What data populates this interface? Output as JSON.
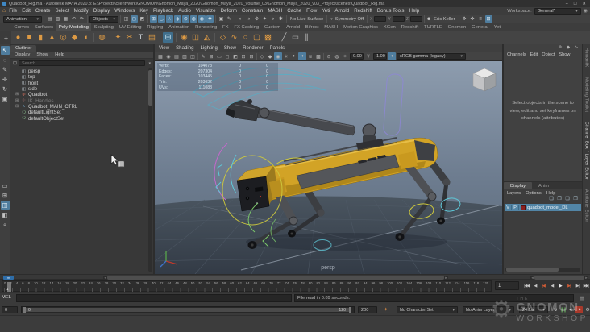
{
  "titlebar": {
    "title": "QuadBot_Rig.ma - Autodesk MAYA 2020.3: E:\\Projects\\clientWork\\GNOMON\\Gnomon_Maya_2020\\Gnomon_Maya_2020_volume_03\\Gnomon_Maya_2020_v03_Project\\scenes\\QuadBot_Rig.ma",
    "controls": [
      {
        "name": "minimize-button",
        "glyph": "−"
      },
      {
        "name": "maximize-button",
        "glyph": "□"
      },
      {
        "name": "close-button",
        "glyph": "✕"
      }
    ]
  },
  "menubar": {
    "home_icon": "⌂",
    "items": [
      "File",
      "Edit",
      "Create",
      "Select",
      "Modify",
      "Display",
      "Windows",
      "Key",
      "Playback",
      "Audio",
      "Visualize",
      "Deform",
      "Constrain",
      "MASH",
      "Cache",
      "Flow",
      "Yeti",
      "Arnold",
      "Redshift",
      "Bonus Tools",
      "Help"
    ],
    "workspace_label": "Workspace:",
    "workspace_value": "General*",
    "lock_glyph": "◉"
  },
  "statusline": {
    "mode_dropdown": "Animation",
    "file_icons": [
      {
        "name": "new-scene-icon",
        "glyph": "▤"
      },
      {
        "name": "open-scene-icon",
        "glyph": "▨"
      },
      {
        "name": "save-scene-icon",
        "glyph": "▦"
      },
      {
        "name": "undo-icon",
        "glyph": "↶"
      },
      {
        "name": "redo-icon",
        "glyph": "↷"
      }
    ],
    "selection_dropdown": "Objects",
    "mask_icons": [
      {
        "name": "select-hierarchy-icon",
        "glyph": "◫"
      },
      {
        "name": "select-object-icon",
        "glyph": "◻",
        "active": true
      },
      {
        "name": "select-component-icon",
        "glyph": "◩"
      }
    ],
    "snap_icons": [
      {
        "name": "snap-grid-icon",
        "glyph": "⊞",
        "active": true
      },
      {
        "name": "snap-curve-icon",
        "glyph": "◡",
        "active": true
      },
      {
        "name": "snap-point-icon",
        "glyph": "∴",
        "active": true
      },
      {
        "name": "snap-projected-center-icon",
        "glyph": "◈",
        "active": true
      },
      {
        "name": "snap-view-plane-icon",
        "glyph": "⊙",
        "active": true
      },
      {
        "name": "make-live-icon",
        "glyph": "◍",
        "active": true
      },
      {
        "name": "quick-snap-icon",
        "glyph": "◉",
        "active": true
      },
      {
        "name": "snap-together-icon",
        "glyph": "❖",
        "active": true
      }
    ],
    "lock_icons": [
      {
        "name": "lock-selection-icon",
        "glyph": "▣"
      },
      {
        "name": "highlight-selection-icon",
        "glyph": "✎"
      }
    ],
    "render_icons": [
      {
        "name": "render-view-icon",
        "glyph": "◐"
      },
      {
        "name": "ipr-render-icon",
        "glyph": "◑"
      },
      {
        "name": "render-settings-icon",
        "glyph": "⚙"
      },
      {
        "name": "hypershade-icon",
        "glyph": "✦"
      },
      {
        "name": "light-editor-icon",
        "glyph": "◕"
      },
      {
        "name": "paint-effects-icon",
        "glyph": "✱"
      }
    ],
    "no_live_surface": "No Live Surface",
    "symmetry_label": "Symmetry Off",
    "xyz_labels": [
      "X",
      "Y",
      "Z"
    ],
    "user_icon": "☻",
    "user": "Eric Keller",
    "right_icons": [
      {
        "name": "modeling-toolkit-toggle-icon",
        "glyph": "❖"
      },
      {
        "name": "humanik-toggle-icon",
        "glyph": "✥"
      },
      {
        "name": "attribute-editor-toggle-icon",
        "glyph": "≡"
      },
      {
        "name": "channel-box-toggle-icon",
        "glyph": "⊞",
        "active": true
      }
    ]
  },
  "shelf": {
    "left_icons": [
      {
        "name": "shelf-tab-menu-icon",
        "glyph": "▾"
      },
      {
        "name": "shelf-options-icon",
        "glyph": "✚"
      }
    ],
    "tabs": [
      {
        "name": "shelf-tab-curves",
        "label": "Curves"
      },
      {
        "name": "shelf-tab-surfaces",
        "label": "Surfaces"
      },
      {
        "name": "shelf-tab-poly-modeling",
        "label": "Poly Modeling",
        "active": true
      },
      {
        "name": "shelf-tab-sculpting",
        "label": "Sculpting"
      },
      {
        "name": "shelf-tab-uv-editing",
        "label": "UV Editing"
      },
      {
        "name": "shelf-tab-rigging",
        "label": "Rigging"
      },
      {
        "name": "shelf-tab-animation",
        "label": "Animation"
      },
      {
        "name": "shelf-tab-rendering",
        "label": "Rendering"
      },
      {
        "name": "shelf-tab-fx",
        "label": "FX"
      },
      {
        "name": "shelf-tab-fx-caching",
        "label": "FX Caching"
      },
      {
        "name": "shelf-tab-custom",
        "label": "Custom"
      },
      {
        "name": "shelf-tab-arnold",
        "label": "Arnold"
      },
      {
        "name": "shelf-tab-bifrost",
        "label": "Bifrost"
      },
      {
        "name": "shelf-tab-mash",
        "label": "MASH"
      },
      {
        "name": "shelf-tab-motion-graphics",
        "label": "Motion Graphics"
      },
      {
        "name": "shelf-tab-xgen",
        "label": "XGen"
      },
      {
        "name": "shelf-tab-redshift",
        "label": "Redshift"
      },
      {
        "name": "shelf-tab-turtle",
        "label": "TURTLE"
      },
      {
        "name": "shelf-tab-gnomon",
        "label": "Gnomon"
      },
      {
        "name": "shelf-tab-general",
        "label": "General"
      },
      {
        "name": "shelf-tab-yeti",
        "label": "Yeti"
      }
    ],
    "icons": [
      {
        "name": "poly-sphere-icon",
        "glyph": "●"
      },
      {
        "name": "poly-cube-icon",
        "glyph": "■"
      },
      {
        "name": "poly-cylinder-icon",
        "glyph": "▮"
      },
      {
        "name": "poly-cone-icon",
        "glyph": "▲"
      },
      {
        "name": "poly-torus-icon",
        "glyph": "◎"
      },
      {
        "name": "poly-plane-icon",
        "glyph": "◆"
      },
      {
        "name": "poly-disc-icon",
        "glyph": "◖"
      },
      {
        "sep": true
      },
      {
        "name": "platonic-solid-icon",
        "glyph": "◍"
      },
      {
        "sep": true
      },
      {
        "name": "boolean-icon",
        "glyph": "✦"
      },
      {
        "name": "multi-cut-icon",
        "glyph": "✂"
      },
      {
        "name": "type-tool-icon",
        "glyph": "T",
        "color": "#cdd2d6"
      },
      {
        "name": "sweep-mesh-icon",
        "glyph": "▤"
      },
      {
        "sep": true
      },
      {
        "name": "modeling-toolkit-icon",
        "glyph": "⊞",
        "active": true
      },
      {
        "sep": true
      },
      {
        "name": "smooth-mesh-icon",
        "glyph": "◉"
      },
      {
        "name": "mirror-icon",
        "glyph": "◫"
      },
      {
        "name": "bevel-icon",
        "glyph": "◭"
      },
      {
        "sep": true
      },
      {
        "name": "quad-draw-icon",
        "glyph": "◇"
      },
      {
        "name": "curve-tool-icon",
        "glyph": "∿"
      },
      {
        "name": "circle-curve-icon",
        "glyph": "○"
      },
      {
        "name": "square-curve-icon",
        "glyph": "▢"
      },
      {
        "name": "lattice-icon",
        "glyph": "▩"
      },
      {
        "sep": true
      },
      {
        "name": "pencil-tool-icon",
        "glyph": "╱",
        "color": "#b5b5b5"
      },
      {
        "name": "frame-tool-icon",
        "glyph": "▭",
        "color": "#b5b5b5"
      },
      {
        "name": "hatch-tool-icon",
        "glyph": "∥",
        "color": "#b5b5b5"
      }
    ]
  },
  "toolbox": {
    "tools": [
      {
        "name": "select-tool",
        "glyph": "↖",
        "active": true
      },
      {
        "name": "lasso-select-tool",
        "glyph": "◌"
      },
      {
        "name": "paint-select-tool",
        "glyph": "✎"
      },
      {
        "name": "move-tool",
        "glyph": "✛"
      },
      {
        "name": "rotate-tool",
        "glyph": "↻"
      },
      {
        "name": "scale-tool",
        "glyph": "▣"
      }
    ],
    "layouts": [
      {
        "name": "layout-single-pane",
        "glyph": "▭"
      },
      {
        "name": "layout-four-pane",
        "glyph": "⊞"
      },
      {
        "name": "layout-two-pane",
        "glyph": "◫",
        "active": true
      },
      {
        "name": "layout-outliner-persp",
        "glyph": "◧"
      },
      {
        "name": "zoom-tool",
        "glyph": "⌕"
      }
    ]
  },
  "outliner": {
    "tab": "Outliner",
    "menus": [
      "Display",
      "Show",
      "Help"
    ],
    "search_placeholder": "Search...",
    "filter_icon": "⊡",
    "items": [
      {
        "name": "outliner-item-persp",
        "glyph": "◧",
        "glyphColor": "#a9afb5",
        "label": "persp",
        "indent": true
      },
      {
        "name": "outliner-item-top",
        "glyph": "◧",
        "glyphColor": "#a9afb5",
        "label": "top",
        "indent": true
      },
      {
        "name": "outliner-item-front",
        "glyph": "◧",
        "glyphColor": "#a9afb5",
        "label": "front",
        "indent": true
      },
      {
        "name": "outliner-item-side",
        "glyph": "◧",
        "glyphColor": "#a9afb5",
        "label": "side",
        "indent": true
      },
      {
        "name": "outliner-item-quadbot",
        "expander": "⊞",
        "glyph": "✛",
        "glyphColor": "#c06a5a",
        "label": "Quadbot"
      },
      {
        "name": "outliner-item-ik-handles",
        "expander": "⊞",
        "glyph": "✛",
        "glyphColor": "#9a6a6a",
        "label": "IK_Handles",
        "muted": true
      },
      {
        "name": "outliner-item-main-ctrl",
        "expander": "⊞",
        "glyph": "∿",
        "glyphColor": "#7ab0d4",
        "label": "Quadbot_MAIN_CTRL"
      },
      {
        "name": "outliner-item-default-light-set",
        "glyph": "❍",
        "glyphColor": "#86b98a",
        "label": "defaultLightSet",
        "indent": true
      },
      {
        "name": "outliner-item-default-object-set",
        "glyph": "❍",
        "glyphColor": "#86b98a",
        "label": "defaultObjectSet",
        "indent": true
      }
    ]
  },
  "viewport": {
    "menus": [
      "View",
      "Shading",
      "Lighting",
      "Show",
      "Renderer",
      "Panels"
    ],
    "toolbar_icons": [
      {
        "name": "select-camera-icon",
        "glyph": "▦"
      },
      {
        "name": "lock-camera-icon",
        "glyph": "◉"
      },
      {
        "name": "camera-attributes-icon",
        "glyph": "▤"
      },
      {
        "name": "bookmarks-icon",
        "glyph": "▥"
      },
      {
        "name": "image-plane-icon",
        "glyph": "◫"
      },
      {
        "sep": true
      },
      {
        "name": "grease-pencil-icon",
        "glyph": "✎"
      },
      {
        "name": "grid-toggle-icon",
        "glyph": "⊞"
      },
      {
        "name": "film-gate-icon",
        "glyph": "▭"
      },
      {
        "name": "resolution-gate-icon",
        "glyph": "◻"
      },
      {
        "name": "gate-mask-icon",
        "glyph": "◩"
      },
      {
        "name": "field-chart-icon",
        "glyph": "⊡"
      },
      {
        "name": "safe-action-icon",
        "glyph": "⊟"
      },
      {
        "sep": true
      },
      {
        "name": "wireframe-icon",
        "glyph": "◇"
      },
      {
        "name": "shaded-icon",
        "glyph": "◆"
      },
      {
        "name": "textured-icon",
        "glyph": "◉",
        "active": true
      },
      {
        "name": "lights-icon",
        "glyph": "☀"
      },
      {
        "name": "shadows-icon",
        "glyph": "◐"
      },
      {
        "name": "ambient-occlusion-icon",
        "glyph": "◑",
        "active": true
      },
      {
        "name": "motion-blur-icon",
        "glyph": "≋"
      },
      {
        "name": "multisample-icon",
        "glyph": "▩"
      },
      {
        "sep": true
      },
      {
        "name": "isolate-select-icon",
        "glyph": "⊙"
      },
      {
        "name": "xray-icon",
        "glyph": "◍"
      }
    ],
    "exposure_icon": "☼",
    "exposure": "0.00",
    "gamma_icon": "γ",
    "gamma": "1.00",
    "colorspace_icon": "◑",
    "colorspace": "sRGB gamma (legacy)",
    "hud": [
      {
        "label": "Verts:",
        "value": "104078",
        "col2": "0",
        "col3": "0"
      },
      {
        "label": "Edges:",
        "value": "207304",
        "col2": "0",
        "col3": "0"
      },
      {
        "label": "Faces:",
        "value": "103445",
        "col2": "0",
        "col3": "0"
      },
      {
        "label": "Tris:",
        "value": "203632",
        "col2": "0",
        "col3": "0"
      },
      {
        "label": "UVs:",
        "value": "111088",
        "col2": "0",
        "col3": "0"
      }
    ],
    "camera_label": "persp"
  },
  "channelbox": {
    "header_icons": [
      {
        "name": "show-manipulators-icon",
        "glyph": "✛"
      },
      {
        "name": "speed-ramp-icon",
        "glyph": "◆"
      },
      {
        "name": "channel-graph-icon",
        "glyph": "∿"
      }
    ],
    "menus": [
      "Channels",
      "Edit",
      "Object",
      "Show"
    ],
    "empty_message": "Select objects in the scene to view, edit and set keyframes on channels (attributes)"
  },
  "layers": {
    "tabs": [
      {
        "name": "layer-tab-display",
        "label": "Display",
        "active": true
      },
      {
        "name": "layer-tab-anim",
        "label": "Anim"
      }
    ],
    "menus": [
      "Layers",
      "Options",
      "Help"
    ],
    "icons": [
      {
        "name": "move-layer-up-icon",
        "glyph": "❏"
      },
      {
        "name": "move-layer-down-icon",
        "glyph": "❐"
      },
      {
        "name": "empty-layer-icon",
        "glyph": "❑"
      },
      {
        "name": "new-layer-icon",
        "glyph": "❒"
      }
    ],
    "row": {
      "visibility": "V",
      "playback": "P",
      "color": "#8b2020",
      "label": "quadbot_model_DL"
    }
  },
  "side_tabs": [
    {
      "name": "tab-humanik",
      "label": "HumanIK"
    },
    {
      "name": "tab-modeling-toolkit",
      "label": "Modeling Toolkit"
    },
    {
      "name": "tab-channel-box-layer-editor",
      "label": "Channel Box / Layer Editor",
      "active": true
    },
    {
      "name": "tab-attribute-editor",
      "label": "Attribute Editor"
    }
  ],
  "timeline": {
    "ticks": [
      "0",
      "2",
      "4",
      "6",
      "8",
      "10",
      "12",
      "14",
      "16",
      "18",
      "20",
      "22",
      "24",
      "26",
      "28",
      "30",
      "32",
      "34",
      "36",
      "38",
      "40",
      "42",
      "44",
      "46",
      "48",
      "50",
      "52",
      "54",
      "56",
      "58",
      "60",
      "62",
      "64",
      "66",
      "68",
      "70",
      "72",
      "74",
      "76",
      "78",
      "80",
      "82",
      "84",
      "86",
      "88",
      "90",
      "92",
      "94",
      "96",
      "98",
      "100",
      "102",
      "104",
      "106",
      "108",
      "110",
      "112",
      "114",
      "116",
      "118",
      "120"
    ],
    "current_frame": "1",
    "playback": [
      {
        "name": "go-to-start-button",
        "glyph": "|◀◀"
      },
      {
        "name": "step-back-frame-button",
        "glyph": "|◀"
      },
      {
        "name": "step-back-key-button",
        "glyph": "|◀",
        "color": "#cf5b35"
      },
      {
        "name": "play-backwards-button",
        "glyph": "◀"
      },
      {
        "name": "play-forward-button",
        "glyph": "▶",
        "color": "#e8e8e8"
      },
      {
        "name": "step-forward-key-button",
        "glyph": "▶|",
        "color": "#cf5b35"
      },
      {
        "name": "step-forward-frame-button",
        "glyph": "▶|"
      },
      {
        "name": "go-to-end-button",
        "glyph": "▶▶|"
      }
    ]
  },
  "range": {
    "anim_start": "0",
    "range_start_label": "0",
    "range_end_label": "120",
    "anim_end": "200",
    "key_icon": "✦",
    "character_set": "No Character Set",
    "anim_layer": "No Anim Layer",
    "fps": "24 fps",
    "icons": [
      {
        "name": "loop-toggle-icon",
        "glyph": "↻"
      },
      {
        "name": "range-bookmark-icon",
        "glyph": "❙❙",
        "color": "#6dbf63"
      },
      {
        "name": "mute-audio-icon",
        "glyph": "◄»"
      },
      {
        "name": "auto-keyframe-toggle",
        "glyph": "✦",
        "active": true
      },
      {
        "name": "animation-preferences-icon",
        "glyph": "⚙"
      }
    ]
  },
  "commandline": {
    "label": "MEL",
    "result": "File read in  0.89 seconds.",
    "script_editor_icon": "▤"
  },
  "watermark": {
    "the": "THE",
    "line1": "GNOMON",
    "line2": "WORKSHOP"
  }
}
